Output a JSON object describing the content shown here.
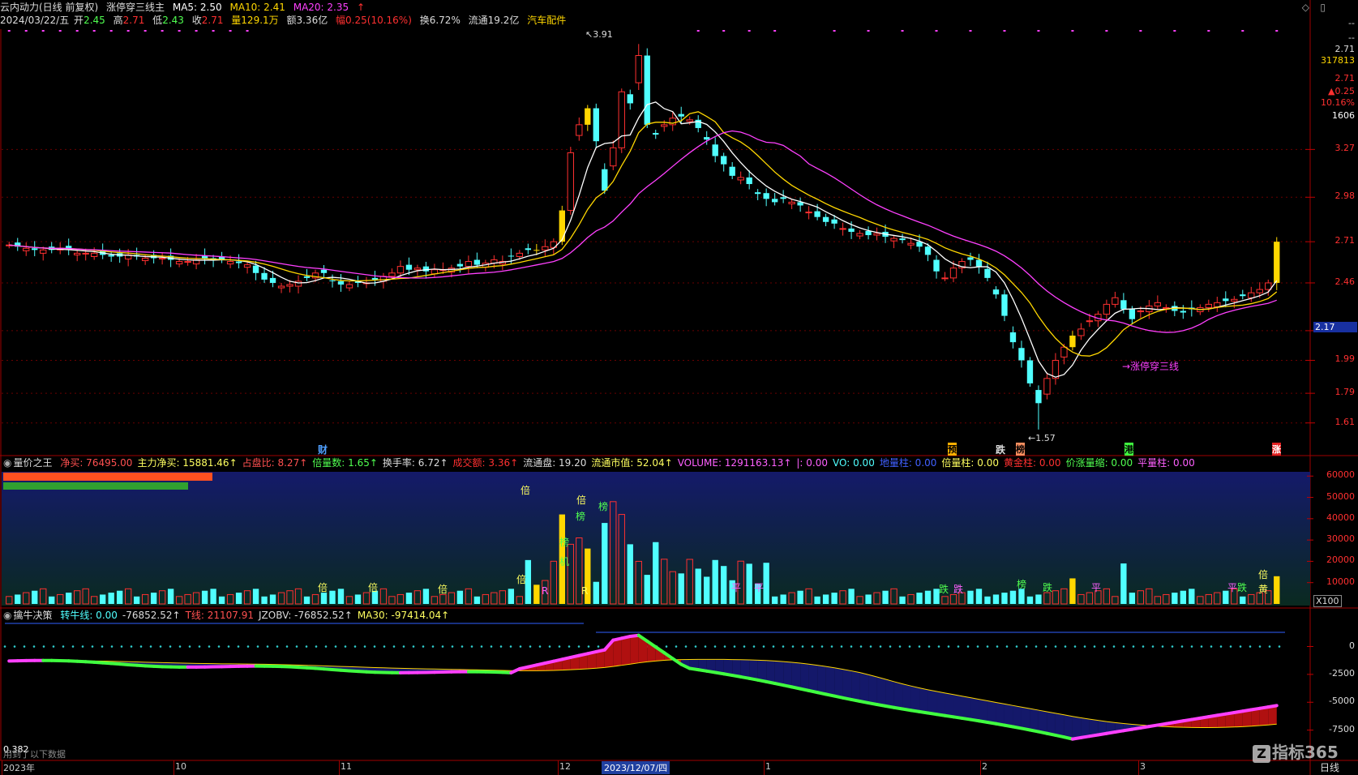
{
  "header": {
    "stock": "云内动力(日线 前复权)",
    "indicator": "涨停穿三线主",
    "ma5": "MA5: 2.50",
    "ma10": "MA10: 2.41",
    "ma20": "MA20: 2.35",
    "arrow": "↑"
  },
  "quote": {
    "date": "2024/03/22/五",
    "open_l": "开",
    "open": "2.45",
    "high_l": "高",
    "high": "2.71",
    "low_l": "低",
    "low": "2.43",
    "close_l": "收",
    "close": "2.71",
    "vol": "量129.1万",
    "amt": "额3.36亿",
    "chg": "幅0.25(10.16%)",
    "turn": "换6.72%",
    "float": "流通19.2亿",
    "sector": "汽车配件"
  },
  "right_axis_top": {
    "dash1": "--",
    "dash2": "--",
    "p1": "2.71",
    "p2": "317813",
    "p3": "2.71",
    "p4": "▲0.25",
    "p5": "10.16%",
    "p6": "1606"
  },
  "price_ticks": [
    "3.27",
    "2.98",
    "2.71",
    "2.46",
    "2.17",
    "1.99",
    "1.79",
    "1.61"
  ],
  "annotations": {
    "high": "3.91",
    "low": "1.57",
    "zt_label": "→涨停穿三线"
  },
  "signals": [
    "财",
    "预",
    "跌",
    "榜",
    "港",
    "涨"
  ],
  "vol_panel": {
    "title": "量价之王",
    "items": [
      {
        "t": "净买: 76495.00",
        "c": "#ff5050"
      },
      {
        "t": "主力净买: 15881.46↑",
        "c": "#ffff60"
      },
      {
        "t": "占盘比: 8.27↑",
        "c": "#ff5050"
      },
      {
        "t": "倍量数: 1.65↑",
        "c": "#50ff50"
      },
      {
        "t": "换手率: 6.72↑",
        "c": "#dddddd"
      },
      {
        "t": "成交额: 3.36↑",
        "c": "#ff3030"
      },
      {
        "t": "流通盘: 19.20",
        "c": "#dddddd"
      },
      {
        "t": "流通市值: 52.04↑",
        "c": "#ffff60"
      },
      {
        "t": "VOLUME: 1291163.13↑",
        "c": "#ff60ff"
      },
      {
        "t": "|: 0.00",
        "c": "#ff60ff"
      },
      {
        "t": "VO: 0.00",
        "c": "#50ffff"
      },
      {
        "t": "地量柱: 0.00",
        "c": "#4060ff"
      },
      {
        "t": "倍量柱: 0.00",
        "c": "#ffff60"
      },
      {
        "t": "黄金柱: 0.00",
        "c": "#ff3030"
      },
      {
        "t": "价涨量缩: 0.00",
        "c": "#50ff50"
      },
      {
        "t": "平量柱: 0.00",
        "c": "#ff60ff"
      }
    ],
    "ticks": [
      "60000",
      "50000",
      "40000",
      "30000",
      "20000",
      "10000"
    ],
    "unit": "X100",
    "marks": [
      "倍",
      "倍",
      "倍",
      "倍",
      "倍",
      "倍",
      "榜",
      "榜",
      "榜",
      "机",
      "R",
      "R",
      "平",
      "平",
      "跌",
      "跌",
      "榜",
      "跌",
      "平",
      "平",
      "跌",
      "倍",
      "黄"
    ]
  },
  "bull_panel": {
    "title": "擒牛决策",
    "items": [
      {
        "t": "转牛线: 0.00",
        "c": "#50ffff"
      },
      {
        "t": "-76852.52↑",
        "c": "#dddddd"
      },
      {
        "t": "T线: 21107.91",
        "c": "#ff5050"
      },
      {
        "t": "JZOBV: -76852.52↑",
        "c": "#dddddd"
      },
      {
        "t": "MA30: -97414.04↑",
        "c": "#ffff60"
      }
    ],
    "ticks": [
      "0",
      "-2500",
      "-5000",
      "-7500"
    ],
    "corner1": "0.382",
    "corner2": "用到了以下数据"
  },
  "date_axis": {
    "labels": [
      "2023年",
      "10",
      "11",
      "12",
      "1",
      "2",
      "3"
    ],
    "cursor": "2023/12/07/四",
    "period": "日线",
    "watermark": "指标365"
  },
  "colors": {
    "up": "#ff3030",
    "down": "#50ffff",
    "zt": "#ffd700",
    "ma5": "#ffffff",
    "ma10": "#ffd700",
    "ma20": "#ff40ff",
    "bull": "#40ff40",
    "bull2": "#ff40ff"
  },
  "chart_data": {
    "type": "candlestick",
    "closes": [
      2.69,
      2.68,
      2.67,
      2.66,
      2.66,
      2.66,
      2.67,
      2.66,
      2.64,
      2.64,
      2.64,
      2.63,
      2.62,
      2.62,
      2.63,
      2.62,
      2.61,
      2.61,
      2.61,
      2.6,
      2.59,
      2.59,
      2.6,
      2.61,
      2.6,
      2.6,
      2.59,
      2.58,
      2.57,
      2.52,
      2.48,
      2.46,
      2.44,
      2.45,
      2.47,
      2.49,
      2.52,
      2.52,
      2.47,
      2.45,
      2.45,
      2.46,
      2.46,
      2.48,
      2.5,
      2.52,
      2.56,
      2.54,
      2.55,
      2.53,
      2.54,
      2.54,
      2.55,
      2.56,
      2.59,
      2.57,
      2.58,
      2.6,
      2.59,
      2.62,
      2.64,
      2.66,
      2.66,
      2.68,
      2.71,
      2.9,
      3.25,
      3.42,
      3.52,
      3.32,
      3.02,
      3.28,
      3.62,
      3.55,
      3.84,
      3.42,
      3.36,
      3.42,
      3.46,
      3.47,
      3.45,
      3.4,
      3.33,
      3.23,
      3.18,
      3.11,
      3.1,
      3.06,
      3.0,
      2.97,
      2.95,
      2.97,
      2.95,
      2.93,
      2.89,
      2.86,
      2.83,
      2.82,
      2.79,
      2.77,
      2.76,
      2.75,
      2.76,
      2.74,
      2.73,
      2.72,
      2.7,
      2.68,
      2.63,
      2.53,
      2.49,
      2.55,
      2.59,
      2.6,
      2.56,
      2.49,
      2.39,
      2.26,
      2.1,
      1.99,
      1.85,
      1.73,
      1.88,
      1.99,
      2.07,
      2.14,
      2.18,
      2.23,
      2.27,
      2.33,
      2.37,
      2.3,
      2.24,
      2.29,
      2.32,
      2.34,
      2.31,
      2.29,
      2.28,
      2.3,
      2.31,
      2.33,
      2.34,
      2.35,
      2.36,
      2.38,
      2.4,
      2.42,
      2.46,
      2.71
    ],
    "high": 3.91,
    "low": 1.57,
    "zt_index": [
      62,
      65,
      68,
      125,
      149
    ],
    "ylim": [
      1.52,
      4.0
    ]
  }
}
